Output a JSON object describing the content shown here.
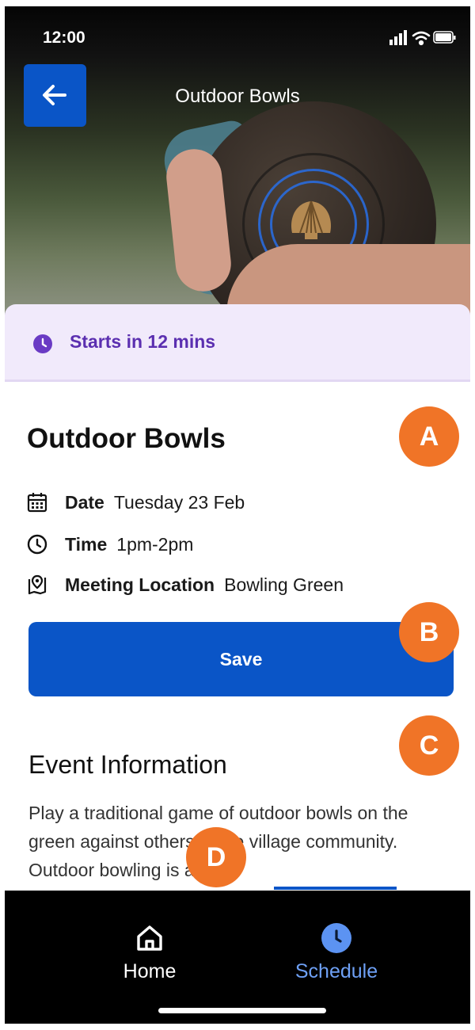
{
  "status_bar": {
    "time": "12:00",
    "icons": [
      "signal-icon",
      "wifi-icon",
      "battery-icon"
    ]
  },
  "header": {
    "title": "Outdoor Bowls",
    "back_icon": "arrow-left-icon"
  },
  "banner": {
    "text": "Starts in 12 mins",
    "icon": "clock-icon",
    "color": "#5b2fb0"
  },
  "event": {
    "title": "Outdoor Bowls",
    "date_label": "Date",
    "date_value": "Tuesday 23 Feb",
    "time_label": "Time",
    "time_value": "1pm-2pm",
    "location_label": "Meeting Location",
    "location_value": "Bowling Green"
  },
  "save_button": {
    "label": "Save",
    "color": "#0a55c7"
  },
  "info": {
    "heading": "Event Information",
    "text": "Play a traditional game of outdoor bowls on the green against others in the village community. Outdoor bowling is a"
  },
  "markers": [
    "A",
    "B",
    "C",
    "D"
  ],
  "bottom_nav": [
    {
      "label": "Home",
      "icon": "home-icon",
      "active": false
    },
    {
      "label": "Schedule",
      "icon": "clock-icon",
      "active": true
    }
  ]
}
